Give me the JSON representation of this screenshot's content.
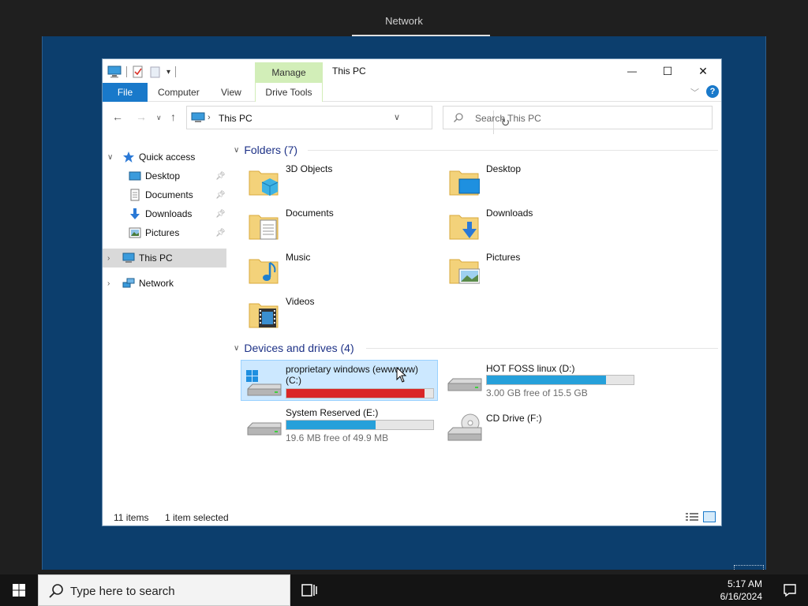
{
  "screen": {
    "title": "Network"
  },
  "window": {
    "title": "This PC",
    "manage_tab": "Manage",
    "controls": {
      "minimize": "—",
      "maximize": "☐",
      "close": "✕"
    }
  },
  "ribbon": {
    "file": "File",
    "computer": "Computer",
    "view": "View",
    "drive_tools": "Drive Tools",
    "help": "?"
  },
  "address": {
    "crumb_sep": "›",
    "path": "This PC",
    "search_placeholder": "Search This PC"
  },
  "nav": {
    "quick_access": "Quick access",
    "items": [
      {
        "label": "Desktop"
      },
      {
        "label": "Documents"
      },
      {
        "label": "Downloads"
      },
      {
        "label": "Pictures"
      }
    ],
    "this_pc": "This PC",
    "network": "Network"
  },
  "folders": {
    "header": "Folders (7)",
    "items": [
      {
        "label": "3D Objects",
        "icon": "3d-objects-icon"
      },
      {
        "label": "Desktop",
        "icon": "desktop-folder-icon"
      },
      {
        "label": "Documents",
        "icon": "documents-folder-icon"
      },
      {
        "label": "Downloads",
        "icon": "downloads-folder-icon"
      },
      {
        "label": "Music",
        "icon": "music-folder-icon"
      },
      {
        "label": "Pictures",
        "icon": "pictures-folder-icon"
      },
      {
        "label": "Videos",
        "icon": "videos-folder-icon"
      }
    ]
  },
  "drives": {
    "header": "Devices and drives (4)",
    "items": [
      {
        "name": "proprietary windows (ewwwww) (C:)",
        "used_fraction": 0.94,
        "free_text": "",
        "selected": true
      },
      {
        "name": "HOT FOSS linux (D:)",
        "used_fraction": 0.81,
        "free_text": "3.00 GB free of 15.5 GB",
        "selected": false
      },
      {
        "name": "System Reserved (E:)",
        "used_fraction": 0.61,
        "free_text": "19.6 MB free of 49.9 MB",
        "selected": false
      },
      {
        "name": "CD Drive (F:)",
        "free_text": "",
        "selected": false
      }
    ]
  },
  "status": {
    "items_count": "11 items",
    "selection": "1 item selected"
  },
  "taskbar": {
    "search_placeholder": "Type here to search",
    "time": "5:17 AM",
    "date": "6/16/2024"
  },
  "colors": {
    "desktop": "#0c3e6d",
    "accent": "#1979ca",
    "bar_ok": "#26a0da",
    "bar_full": "#da2626",
    "manage_tab": "#d2eeb8"
  }
}
